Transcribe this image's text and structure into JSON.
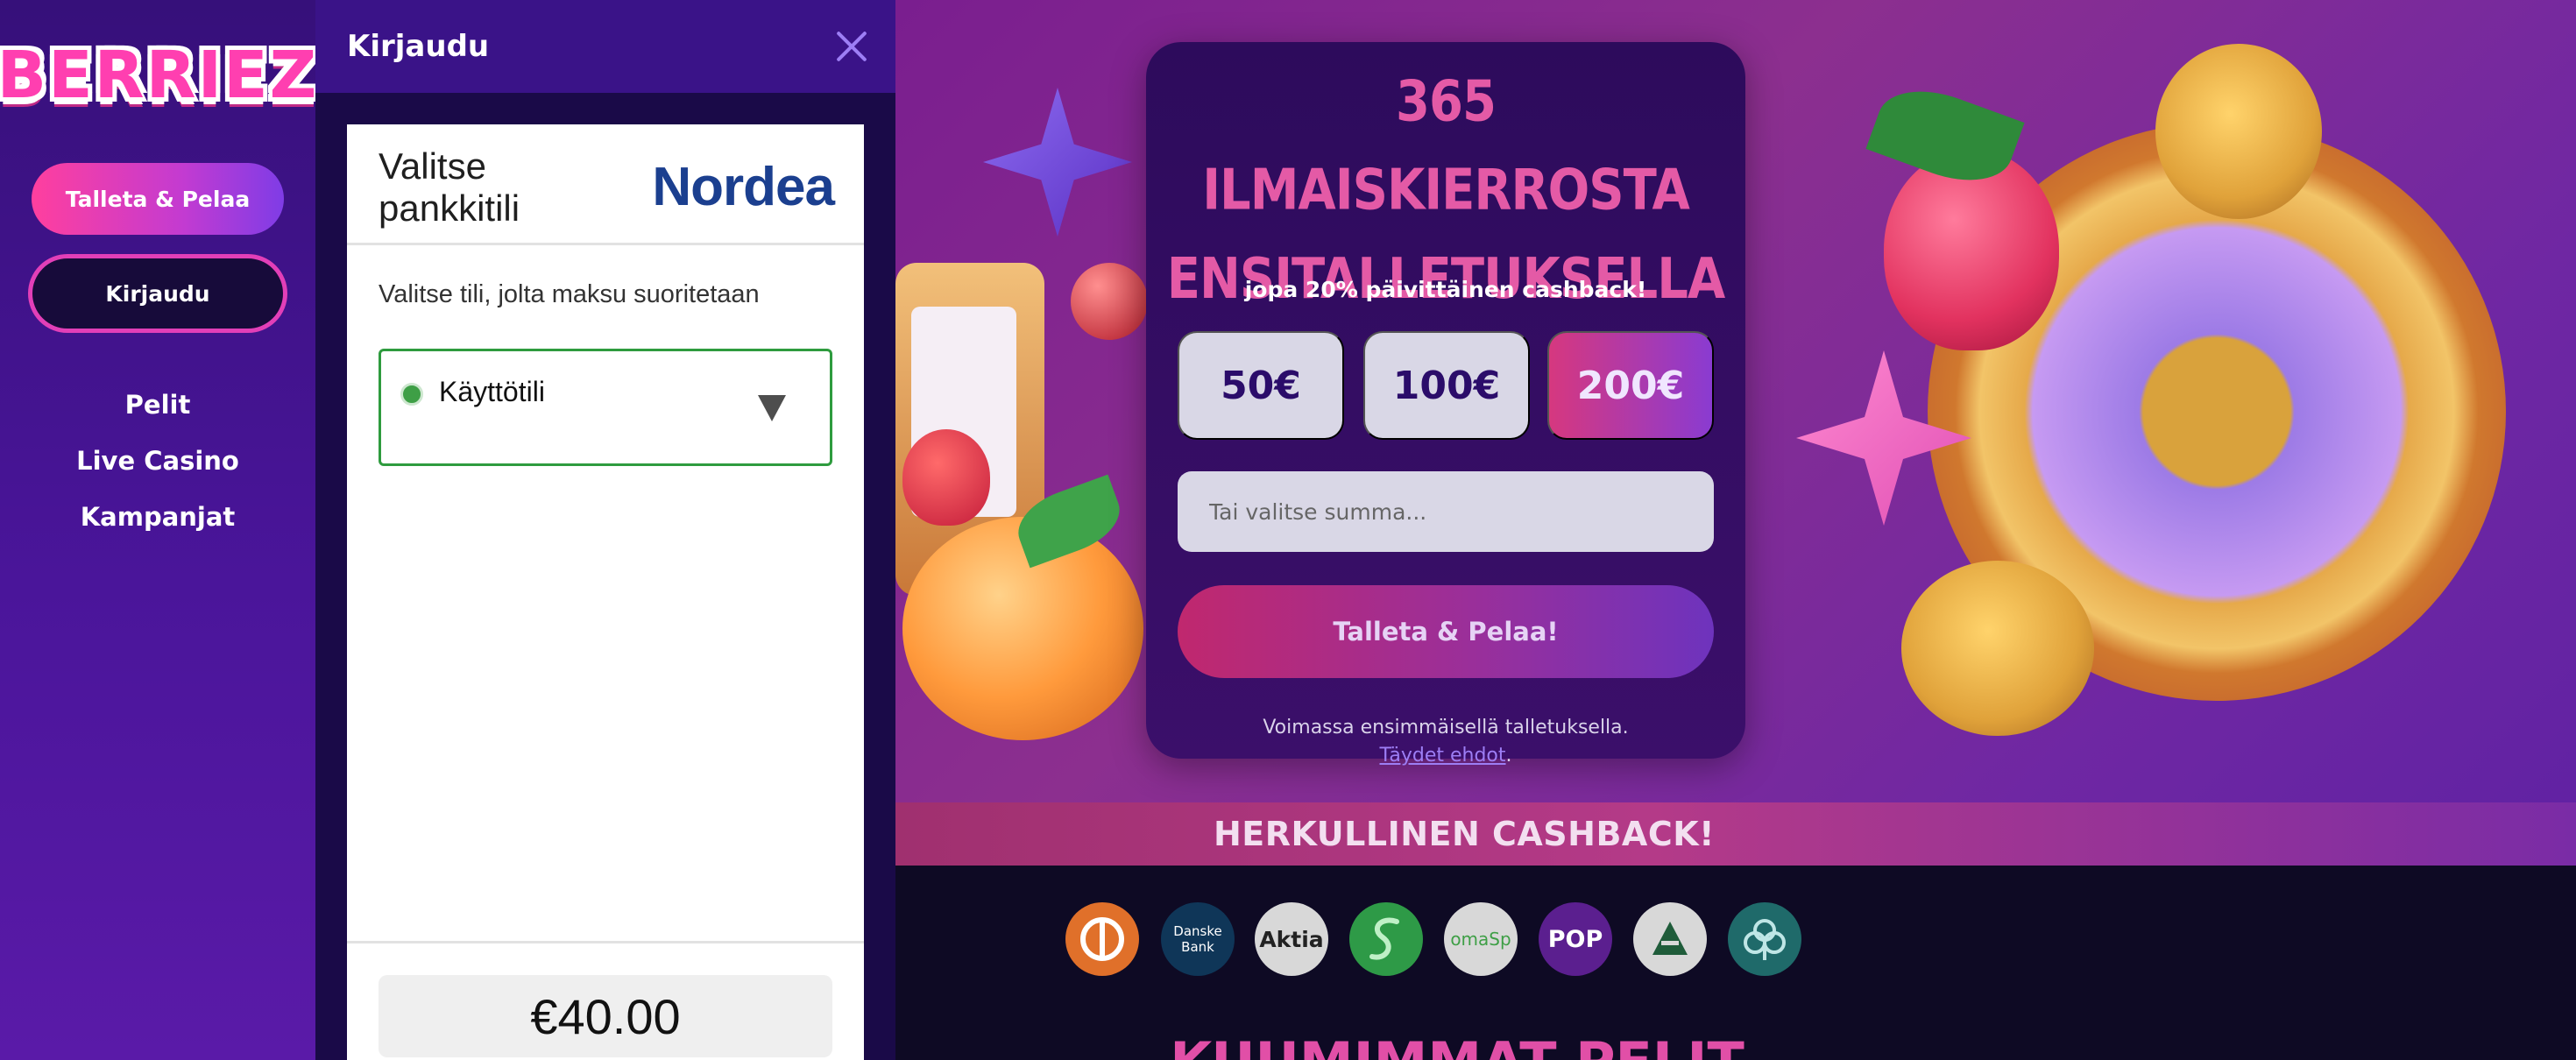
{
  "brand": {
    "logo_text": "BERRIEZ"
  },
  "sidebar": {
    "primary_button": "Talleta & Pelaa",
    "login_button": "Kirjaudu",
    "nav": [
      {
        "label": "Pelit"
      },
      {
        "label": "Live Casino"
      },
      {
        "label": "Kampanjat"
      }
    ]
  },
  "drawer": {
    "title": "Kirjaudu",
    "bank_panel": {
      "title": "Valitse pankkitili",
      "bank_name": "Nordea",
      "instruction": "Valitse tili, jolta maksu suoritetaan",
      "selected_account": "Käyttötili",
      "amount": "€40.00"
    }
  },
  "promo": {
    "headline_line1": "365 ILMAISKIERROSTA",
    "headline_line2": "ENSITALLETUKSELLA",
    "subtitle": "jopa 20% päivittäinen cashback!",
    "amount_options": [
      "50€",
      "100€",
      "200€"
    ],
    "selected_amount": "200€",
    "input_placeholder": "Tai valitse summa...",
    "cta": "Talleta & Pelaa!",
    "terms_text": "Voimassa ensimmäisellä talletuksella.",
    "terms_link": "Täydet ehdot",
    "terms_suffix": "."
  },
  "banner": {
    "text": "HERKULLINEN CASHBACK!"
  },
  "banks": [
    {
      "label": "",
      "icon": "op-icon",
      "color": "#e0702a"
    },
    {
      "label": "Danske Bank",
      "icon": "danske-bank-icon",
      "color": "#0f3658"
    },
    {
      "label": "Aktia",
      "icon": "aktia-icon",
      "color": "#d8d8d8"
    },
    {
      "label": "",
      "icon": "s-pankki-icon",
      "color": "#2e9a47"
    },
    {
      "label": "omaSp",
      "icon": "omasp-icon",
      "color": "#d8d8d8"
    },
    {
      "label": "POP",
      "icon": "pop-pankki-icon",
      "color": "#5b1f8f"
    },
    {
      "label": "",
      "icon": "alandsbanken-icon",
      "color": "#d8d8d8"
    },
    {
      "label": "",
      "icon": "saastopankki-icon",
      "color": "#1f6a6a"
    }
  ],
  "next_section": {
    "title": "KUUMIMMAT PELIT"
  },
  "colors": {
    "accent_pink": "#ff3f9e",
    "accent_purple": "#7f3ce6",
    "nordea_blue": "#1b3f8f",
    "select_green": "#2e9b3e"
  }
}
